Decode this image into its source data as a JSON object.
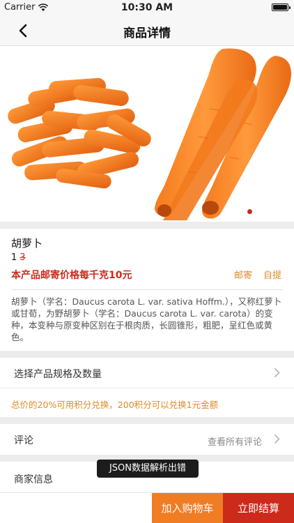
{
  "status_bar": {
    "carrier": "Carrier",
    "time": "10:30 AM",
    "battery_level": 1.0
  },
  "nav": {
    "title": "商品详情",
    "back_icon": "chevron-left-icon"
  },
  "hero": {
    "image": "carrots-photo",
    "pager_dots": 1,
    "active_dot": 1,
    "dot_color": "#cc2a1b"
  },
  "product": {
    "name": "胡萝卜",
    "price": "1",
    "old_price": "3",
    "promo": "本产品邮寄价格每千克10元",
    "ship_mail": "邮寄",
    "ship_pickup": "自提",
    "description": "胡萝卜（学名：Daucus carota L. var. sativa Hoffm.），又称红萝卜或甘荀，为野胡萝卜（学名：Daucus carota L. var. carota）的变种，本变种与原变种区别在于根肉质，长圆锥形，粗肥，呈红色或黄色。"
  },
  "spec": {
    "label": "选择产品规格及数量",
    "points_note": "总价的20%可用积分兑换，200积分可以兑换1元金额"
  },
  "reviews": {
    "label": "评论",
    "link": "查看所有评论"
  },
  "merchant": {
    "label": "商家信息"
  },
  "toast": {
    "message": "JSON数据解析出错"
  },
  "actions": {
    "add_to_cart": "加入购物车",
    "checkout": "立即结算"
  },
  "colors": {
    "primary_red": "#cc2a1b",
    "accent_orange": "#f07c24",
    "highlight_orange": "#e08a2a"
  }
}
